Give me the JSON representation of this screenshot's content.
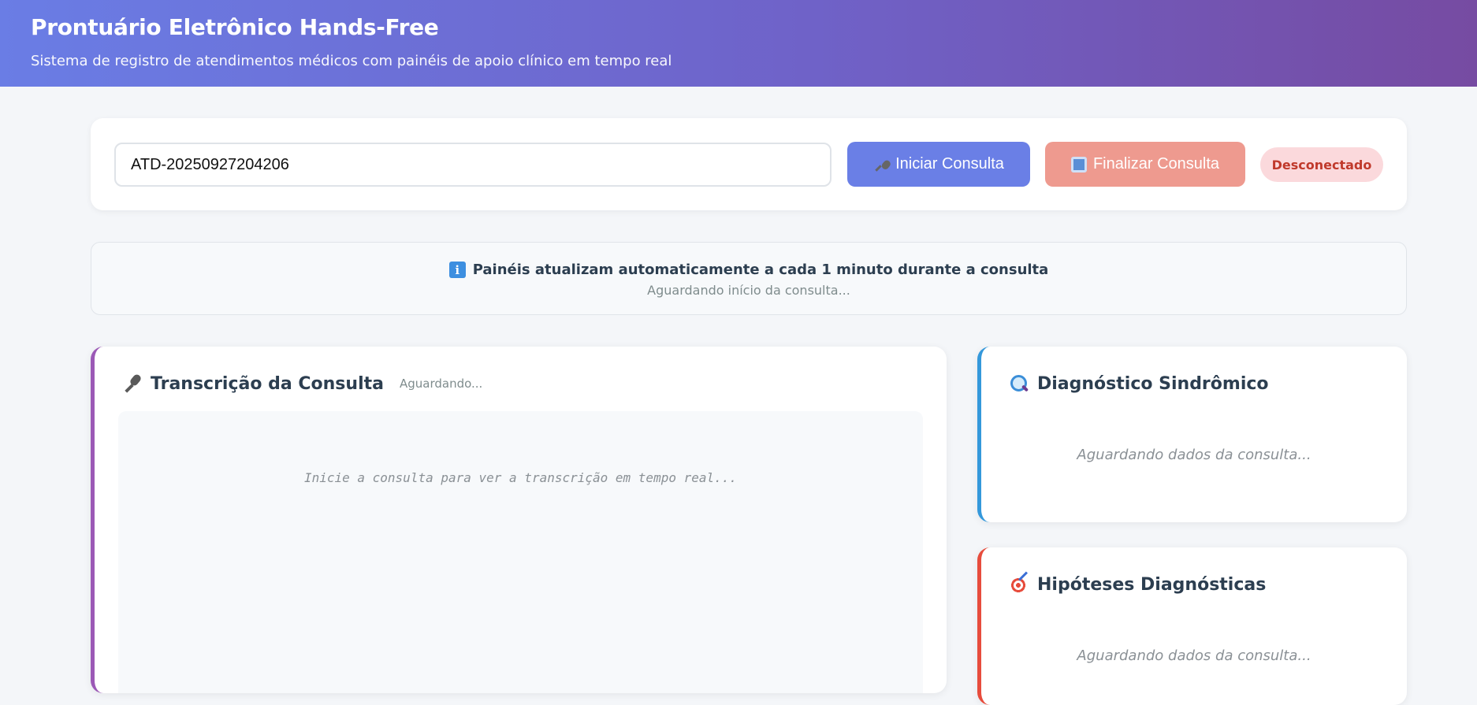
{
  "header": {
    "title": "Prontuário Eletrônico Hands-Free",
    "subtitle": "Sistema de registro de atendimentos médicos com painéis de apoio clínico em tempo real"
  },
  "controls": {
    "attendance_id": "ATD-20250927204206",
    "start_label": "Iniciar Consulta",
    "stop_label": "Finalizar Consulta",
    "connection_status": "Desconectado"
  },
  "info": {
    "title": "Painéis atualizam automaticamente a cada 1 minuto durante a consulta",
    "subtitle": "Aguardando início da consulta..."
  },
  "panels": {
    "transcript": {
      "title": "Transcrição da Consulta",
      "status": "Aguardando...",
      "placeholder": "Inicie a consulta para ver a transcrição em tempo real..."
    },
    "diagnosis": {
      "title": "Diagnóstico Sindrômico",
      "placeholder": "Aguardando dados da consulta..."
    },
    "hypotheses": {
      "title": "Hipóteses Diagnósticas",
      "placeholder": "Aguardando dados da consulta..."
    }
  },
  "colors": {
    "header_gradient_start": "#6a7de5",
    "header_gradient_end": "#764ba2",
    "start_button": "#6a7fe6",
    "stop_button": "#ee9a8f",
    "status_disconnected_bg": "#fbd9dc",
    "status_disconnected_text": "#c0392b",
    "transcript_accent": "#9b59b6",
    "diagnosis_accent": "#3498db",
    "hypotheses_accent": "#e74c3c"
  }
}
